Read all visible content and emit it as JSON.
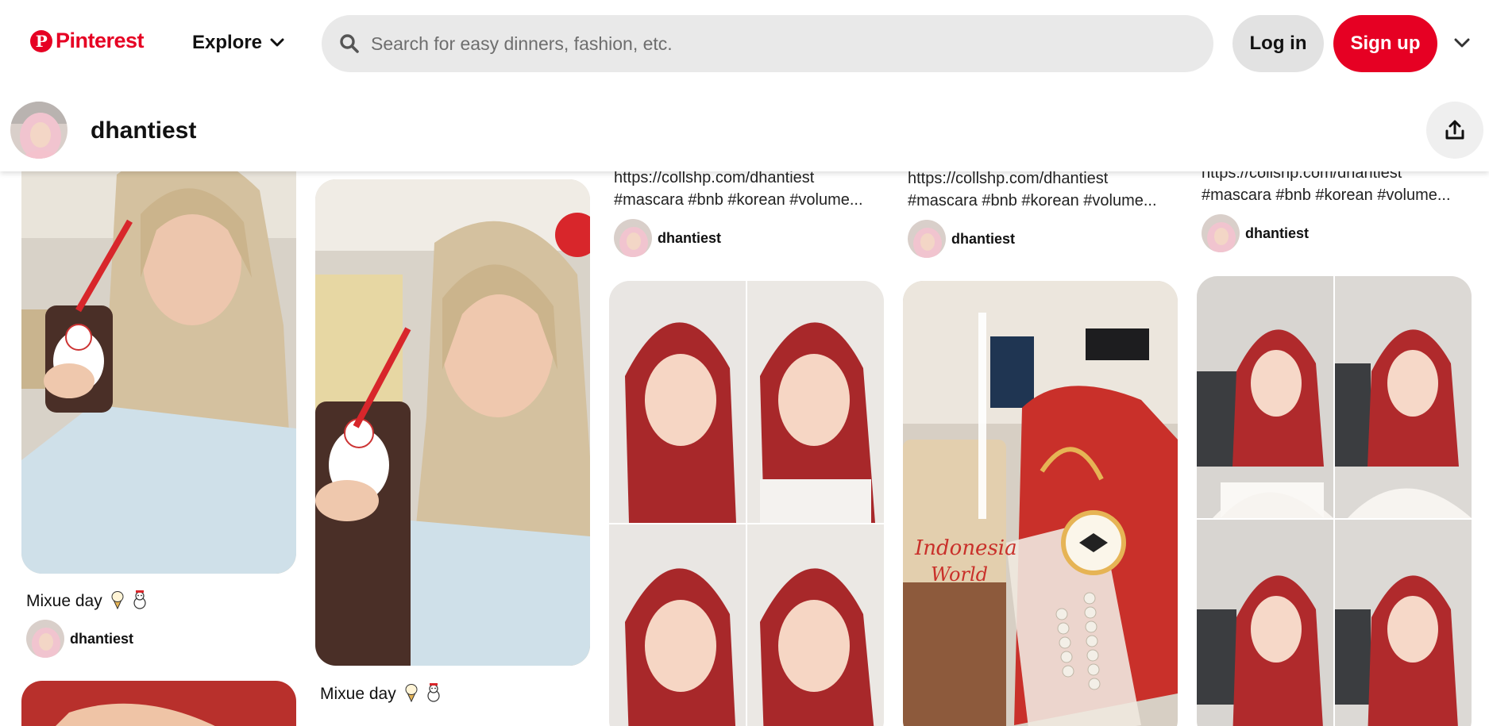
{
  "header": {
    "brand": "Pinterest",
    "brand_mark": "P",
    "explore_label": "Explore",
    "search_placeholder": "Search for easy dinners, fashion, etc.",
    "login_label": "Log in",
    "signup_label": "Sign up",
    "colors": {
      "brand": "#e60023",
      "search_bg": "#e9e9e9",
      "login_bg": "#e2e2e2"
    },
    "icons": [
      "pinterest-logo-icon",
      "chevron-down-icon",
      "search-icon",
      "chevron-down-icon"
    ]
  },
  "profile": {
    "username": "dhantiest",
    "share_icon": "share-icon"
  },
  "pins": [
    {
      "column": 1,
      "image": "woman in beige hijab holding a Mixue drink",
      "title": "Mixue day",
      "title_emoji": [
        "ice-cream-icon",
        "snowman-icon"
      ],
      "author": "dhantiest"
    },
    {
      "column": 1,
      "image": "close-up of red hijab (partially visible)"
    },
    {
      "column": 2,
      "image": "selfie of woman in beige hijab holding a Mixue drink",
      "title": "Mixue day",
      "title_emoji": [
        "ice-cream-icon",
        "snowman-icon"
      ]
    },
    {
      "column": 3,
      "description_line1": "https://collshp.com/dhantiest",
      "description_line2": "#mascara #bnb #korean #volume...",
      "author": "dhantiest"
    },
    {
      "column": 3,
      "image": "four-photo collage of woman in red hijab"
    },
    {
      "column": 4,
      "description_line1": "https://collshp.com/dhantiest",
      "description_line2": "#mascara #bnb #korean #volume...",
      "author": "dhantiest"
    },
    {
      "column": 4,
      "image": "red handbag with bow charm and pearls next to Indonesia World drink"
    },
    {
      "column": 5,
      "description_line1": "https://collshp.com/dhantiest",
      "description_line2": "#mascara #bnb #korean #volume...",
      "author": "dhantiest"
    },
    {
      "column": 5,
      "image": "four-photo collage of woman in red hijab and white sweater"
    }
  ]
}
